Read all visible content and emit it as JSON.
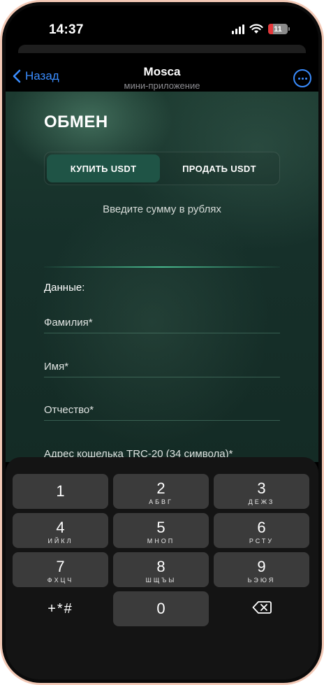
{
  "status_bar": {
    "time": "14:37",
    "battery": "11"
  },
  "header": {
    "back_label": "Назад",
    "title": "Mosca",
    "subtitle": "мини-приложение"
  },
  "exchange": {
    "title": "ОБМЕН",
    "tabs": [
      {
        "label": "КУПИТЬ USDT",
        "active": true
      },
      {
        "label": "ПРОДАТЬ USDT",
        "active": false
      }
    ],
    "amount_hint": "Введите сумму в рублях",
    "data_label": "Данные:",
    "fields": {
      "surname": "Фамилия*",
      "name": "Имя*",
      "patronymic": "Отчество*",
      "wallet": "Адрес кошелька TRC-20 (34 символа)*"
    }
  },
  "keyboard": {
    "keys": [
      {
        "digit": "1",
        "letters": ""
      },
      {
        "digit": "2",
        "letters": "АБВГ"
      },
      {
        "digit": "3",
        "letters": "ДЕЖЗ"
      },
      {
        "digit": "4",
        "letters": "ИЙКЛ"
      },
      {
        "digit": "5",
        "letters": "МНОП"
      },
      {
        "digit": "6",
        "letters": "РСТУ"
      },
      {
        "digit": "7",
        "letters": "ФХЦЧ"
      },
      {
        "digit": "8",
        "letters": "ШЩЪЫ"
      },
      {
        "digit": "9",
        "letters": "ЬЭЮЯ"
      },
      {
        "digit": "0",
        "letters": ""
      }
    ],
    "symbols_label": "+*#"
  },
  "colors": {
    "accent": "#3a8dff",
    "active_tab": "#1f5446",
    "background": "#16302a"
  }
}
